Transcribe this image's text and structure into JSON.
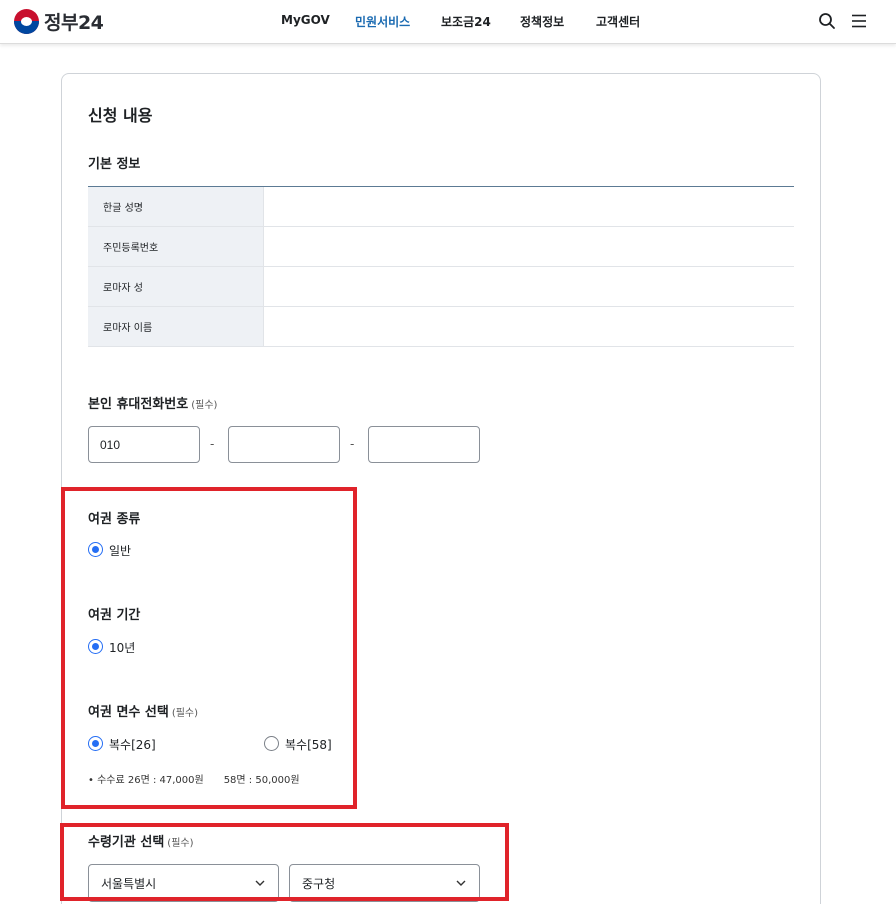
{
  "header": {
    "logo_text": "정부24",
    "nav": [
      "MyGOV",
      "민원서비스",
      "보조금24",
      "정책정보",
      "고객센터"
    ],
    "active_nav": "민원서비스",
    "icons": [
      "search-icon",
      "menu-icon"
    ]
  },
  "form": {
    "title": "신청 내용",
    "basic_info": {
      "heading": "기본 정보",
      "rows": [
        "한글 성명",
        "주민등록번호",
        "로마자 성",
        "로마자 이름"
      ]
    },
    "phone": {
      "label": "본인 휴대전화번호",
      "required": "(필수)",
      "part1": "010",
      "part2": "",
      "part3": "",
      "separator": "-"
    },
    "passport_type": {
      "label": "여권 종류",
      "option": "일반"
    },
    "passport_period": {
      "label": "여권 기간",
      "option": "10년"
    },
    "passport_pages": {
      "label": "여권 면수 선택",
      "required": "(필수)",
      "option1": "복수[26]",
      "option2": "복수[58]",
      "fee_note": "• 수수료 26면 : 47,000원　　58면 : 50,000원"
    },
    "agency": {
      "label": "수령기관 선택",
      "required": "(필수)",
      "city": "서울특별시",
      "district": "중구청"
    }
  },
  "colors": {
    "accent": "#256ef4",
    "active_nav": "#1a6ab1",
    "highlight": "#e0232a"
  }
}
